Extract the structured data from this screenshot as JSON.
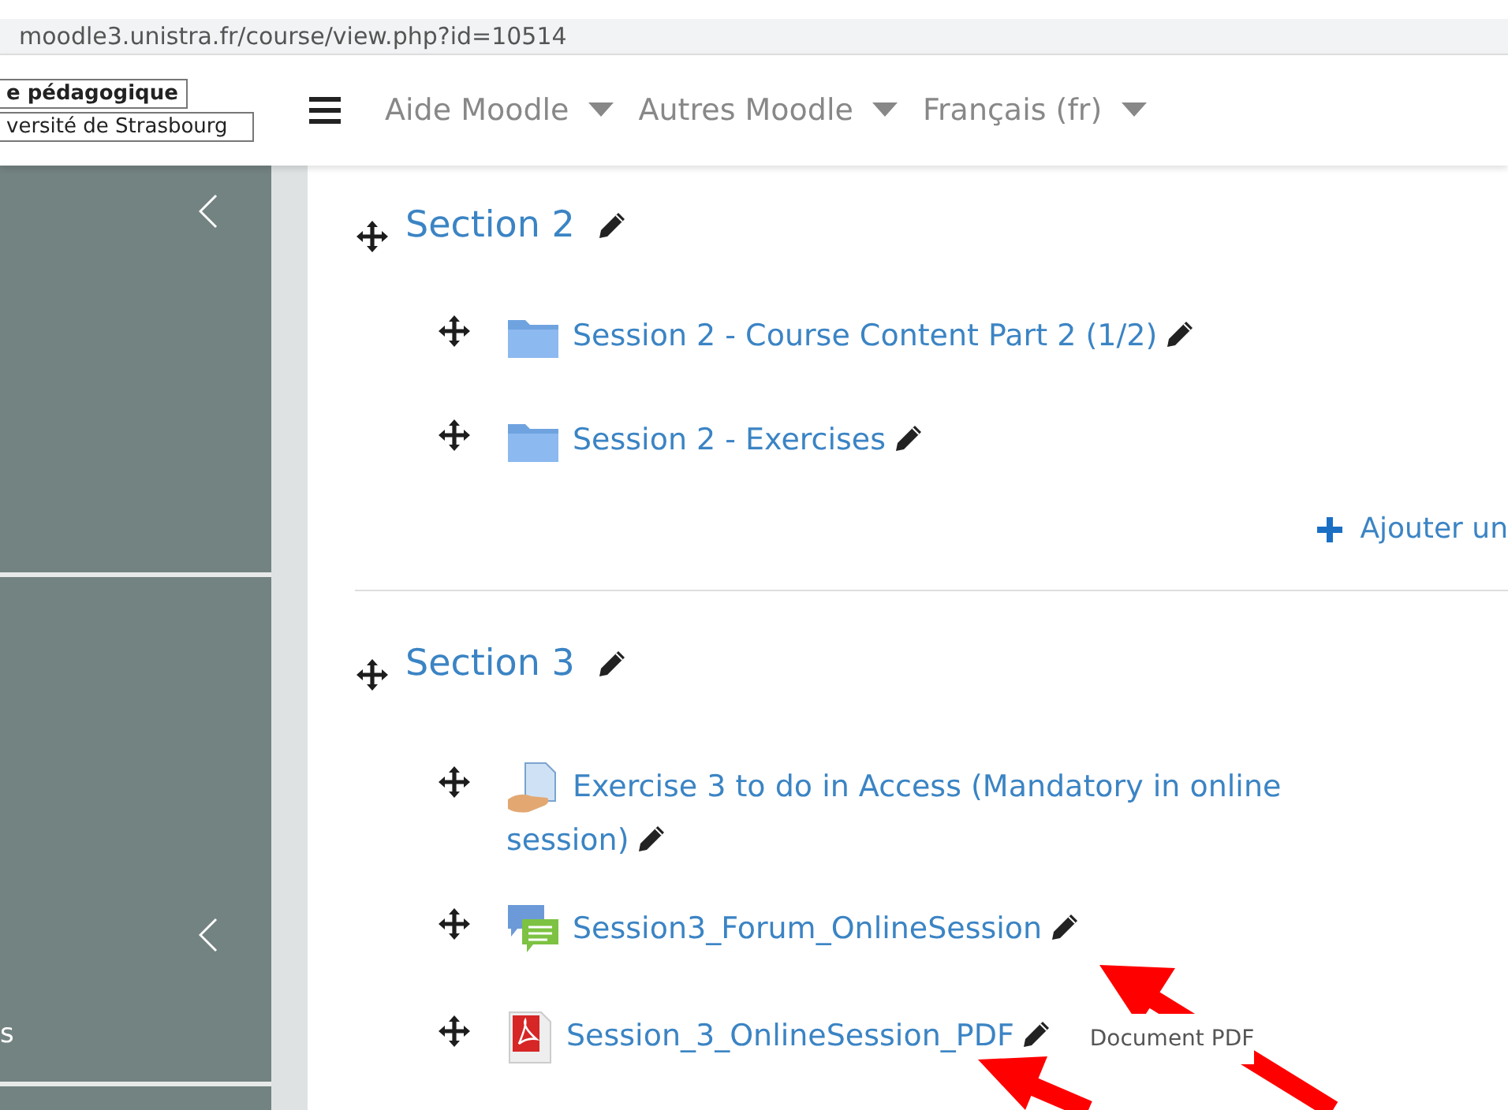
{
  "browser": {
    "url": "moodle3.unistra.fr/course/view.php?id=10514"
  },
  "header": {
    "logo_lines": [
      "e pédagogique",
      "versité de Strasbourg"
    ],
    "menu": [
      {
        "label": "Aide Moodle"
      },
      {
        "label": "Autres Moodle"
      },
      {
        "label": "Français (fr)"
      }
    ]
  },
  "sidebar": {
    "label": "s"
  },
  "sections": [
    {
      "title": "Section 2",
      "activities": [
        {
          "kind": "folder",
          "name": "Session 2 - Course Content Part 2 (1/2)"
        },
        {
          "kind": "folder",
          "name": "Session 2 - Exercises"
        }
      ],
      "add_link": "Ajouter un"
    },
    {
      "title": "Section 3",
      "activities": [
        {
          "kind": "assignment",
          "name": "Exercise 3 to do in Access (Mandatory in online session)"
        },
        {
          "kind": "forum",
          "name": "Session3_Forum_OnlineSession"
        },
        {
          "kind": "pdf",
          "name": "Session_3_OnlineSession_PDF",
          "type_label": "Document PDF"
        }
      ]
    }
  ]
}
